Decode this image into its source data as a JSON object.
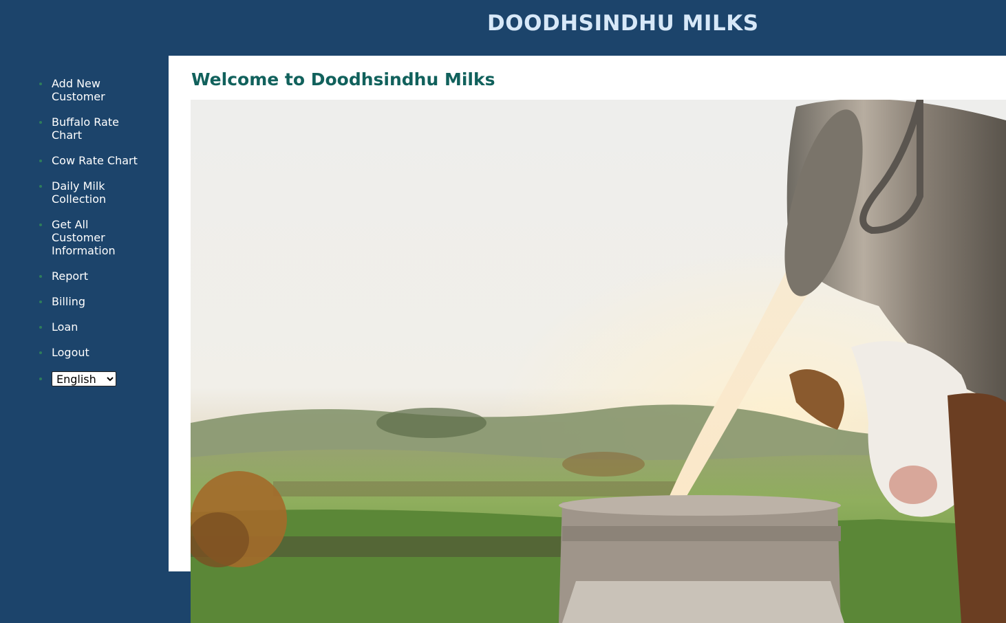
{
  "header": {
    "title": "DOODHSINDHU MILKS"
  },
  "sidebar": {
    "items": [
      {
        "label": "Add New Customer",
        "icon": "bullet-icon"
      },
      {
        "label": "Buffalo Rate Chart",
        "icon": "bullet-icon"
      },
      {
        "label": "Cow Rate Chart",
        "icon": "bullet-icon"
      },
      {
        "label": "Daily Milk Collection",
        "icon": "bullet-icon"
      },
      {
        "label": "Get All Customer Information",
        "icon": "bullet-icon"
      },
      {
        "label": "Report",
        "icon": "bullet-icon"
      },
      {
        "label": "Billing",
        "icon": "bullet-icon"
      },
      {
        "label": "Loan",
        "icon": "bullet-icon"
      },
      {
        "label": "Logout",
        "icon": "bullet-icon"
      }
    ],
    "language": {
      "selected": "English",
      "options": [
        "English"
      ]
    }
  },
  "main": {
    "welcome": "Welcome to Doodhsindhu Milks",
    "hero_image": "milk-pouring-into-can-with-cow-photo"
  },
  "colors": {
    "brand_navy": "#1c446b",
    "title_light": "#d7e8f8",
    "welcome_teal": "#11615c",
    "bullet_green": "#2e7d5b",
    "content_bg": "#ffffff"
  }
}
